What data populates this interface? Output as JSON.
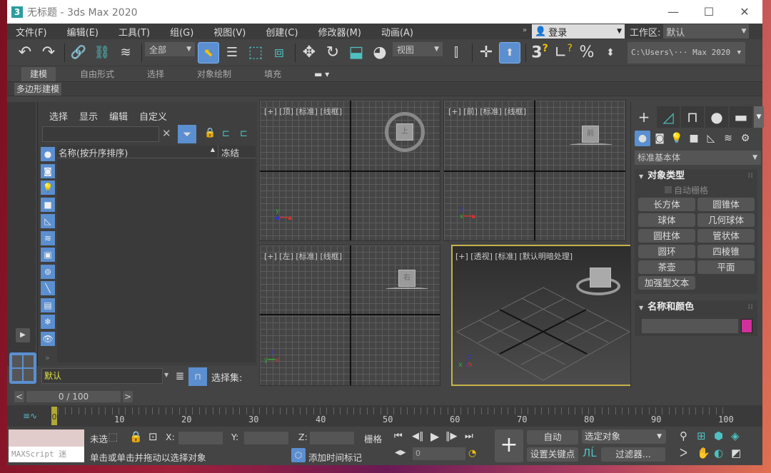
{
  "window": {
    "title": "无标题 - 3ds Max 2020",
    "app_icon": "3",
    "minimize": "—",
    "maximize": "☐",
    "close": "✕"
  },
  "menu": {
    "items": [
      "文件(F)",
      "编辑(E)",
      "工具(T)",
      "组(G)",
      "视图(V)",
      "创建(C)",
      "修改器(M)",
      "动画(A)"
    ],
    "overflow": "»",
    "login": "登录",
    "workspace_label": "工作区:",
    "workspace_value": "默认"
  },
  "toolbar": {
    "selection_filter": "全部",
    "ref_coord": "视图",
    "project_path": "C:\\Users\\··· Max 2020"
  },
  "ribbon": {
    "tabs": [
      "建模",
      "自由形式",
      "选择",
      "对象绘制",
      "填充"
    ],
    "active_tab": "建模",
    "subpanel": "多边形建模"
  },
  "scene_explorer": {
    "menu": [
      "选择",
      "显示",
      "编辑",
      "自定义"
    ],
    "filter_placeholder": "",
    "columns": {
      "name": "名称(按升序排序)",
      "freeze": "冻结"
    },
    "layer": "默认",
    "selection_set_label": "选择集:"
  },
  "viewports": {
    "top": "[+] [顶] [标准] [线框]",
    "front": "[+] [前] [标准] [线框]",
    "left": "[+] [左] [标准] [线框]",
    "perspective": "[+] [透视] [标准] [默认明暗处理]",
    "viewcube_top": "上",
    "viewcube_front": "前",
    "viewcube_left": "右"
  },
  "command_panel": {
    "category": "标准基本体",
    "object_type_title": "对象类型",
    "autogrid": "自动栅格",
    "objects": [
      "长方体",
      "圆锥体",
      "球体",
      "几何球体",
      "圆柱体",
      "管状体",
      "圆环",
      "四棱锥",
      "茶壶",
      "平面",
      "加强型文本"
    ],
    "name_color_title": "名称和颜色",
    "object_color": "#d0309a"
  },
  "timeline": {
    "frame_display": "0 / 100",
    "prev": "<",
    "next": ">",
    "tick_labels": [
      "0",
      "10",
      "20",
      "30",
      "40",
      "50",
      "60",
      "70",
      "80",
      "90",
      "100"
    ],
    "current_frame": "0"
  },
  "status": {
    "maxscript": "MAXScript 迷",
    "selection_status": "未选",
    "x_label": "X:",
    "y_label": "Y:",
    "z_label": "Z:",
    "grid_label": "栅格",
    "prompt": "单击或单击并拖动以选择对象",
    "add_time_tag": "添加时间标记",
    "frame_value": "0",
    "auto_key": "自动",
    "set_key": "设置关键点",
    "key_filter_target": "选定对象",
    "filters": "过滤器..."
  }
}
